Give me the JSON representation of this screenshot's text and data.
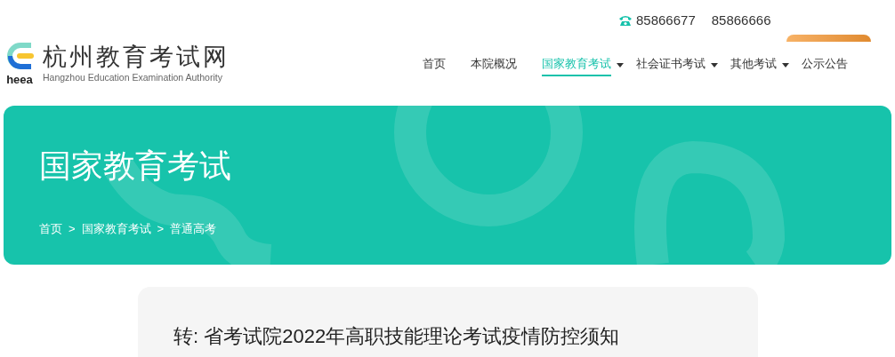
{
  "header": {
    "phones": [
      "85866677",
      "85866666"
    ],
    "logo": {
      "mark_text": "heea",
      "title": "杭州教育考试网",
      "subtitle": "Hangzhou Education Examination Authority"
    }
  },
  "nav": [
    {
      "label": "首页",
      "selected": false,
      "dropdown": false
    },
    {
      "label": "本院概况",
      "selected": false,
      "dropdown": false
    },
    {
      "label": "国家教育考试",
      "selected": true,
      "dropdown": true
    },
    {
      "label": "社会证书考试",
      "selected": false,
      "dropdown": true
    },
    {
      "label": "其他考试",
      "selected": false,
      "dropdown": true
    },
    {
      "label": "公示公告",
      "selected": false,
      "dropdown": false
    }
  ],
  "banner": {
    "title": "国家教育考试",
    "breadcrumb": [
      "首页",
      "国家教育考试",
      "普通高考"
    ],
    "separator": ">"
  },
  "article": {
    "title": "转: 省考试院2022年高职技能理论考试疫情防控须知"
  }
}
